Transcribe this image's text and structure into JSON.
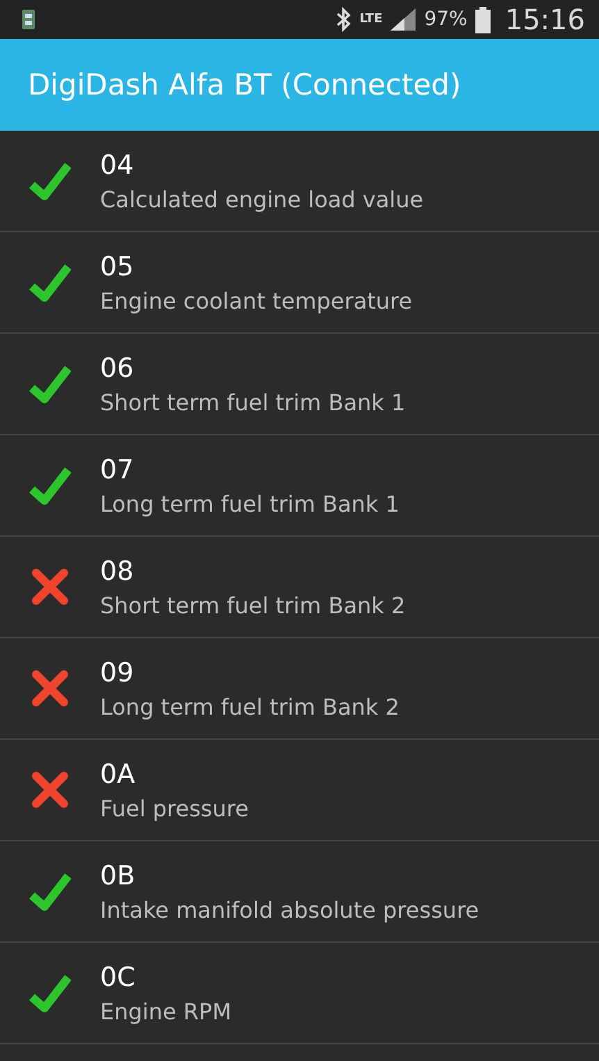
{
  "status_bar": {
    "network": "LTE",
    "battery": "97%",
    "time": "15:16"
  },
  "app_bar": {
    "title": "DigiDash Alfa BT (Connected)"
  },
  "pids": [
    {
      "code": "04",
      "name": "Calculated engine load value",
      "supported": true
    },
    {
      "code": "05",
      "name": "Engine coolant temperature",
      "supported": true
    },
    {
      "code": "06",
      "name": "Short term fuel trim Bank 1",
      "supported": true
    },
    {
      "code": "07",
      "name": "Long term fuel trim Bank 1",
      "supported": true
    },
    {
      "code": "08",
      "name": "Short term fuel trim Bank 2",
      "supported": false
    },
    {
      "code": "09",
      "name": "Long term fuel trim Bank 2",
      "supported": false
    },
    {
      "code": "0A",
      "name": "Fuel pressure",
      "supported": false
    },
    {
      "code": "0B",
      "name": "Intake manifold absolute pressure",
      "supported": true
    },
    {
      "code": "0C",
      "name": "Engine RPM",
      "supported": true
    }
  ]
}
